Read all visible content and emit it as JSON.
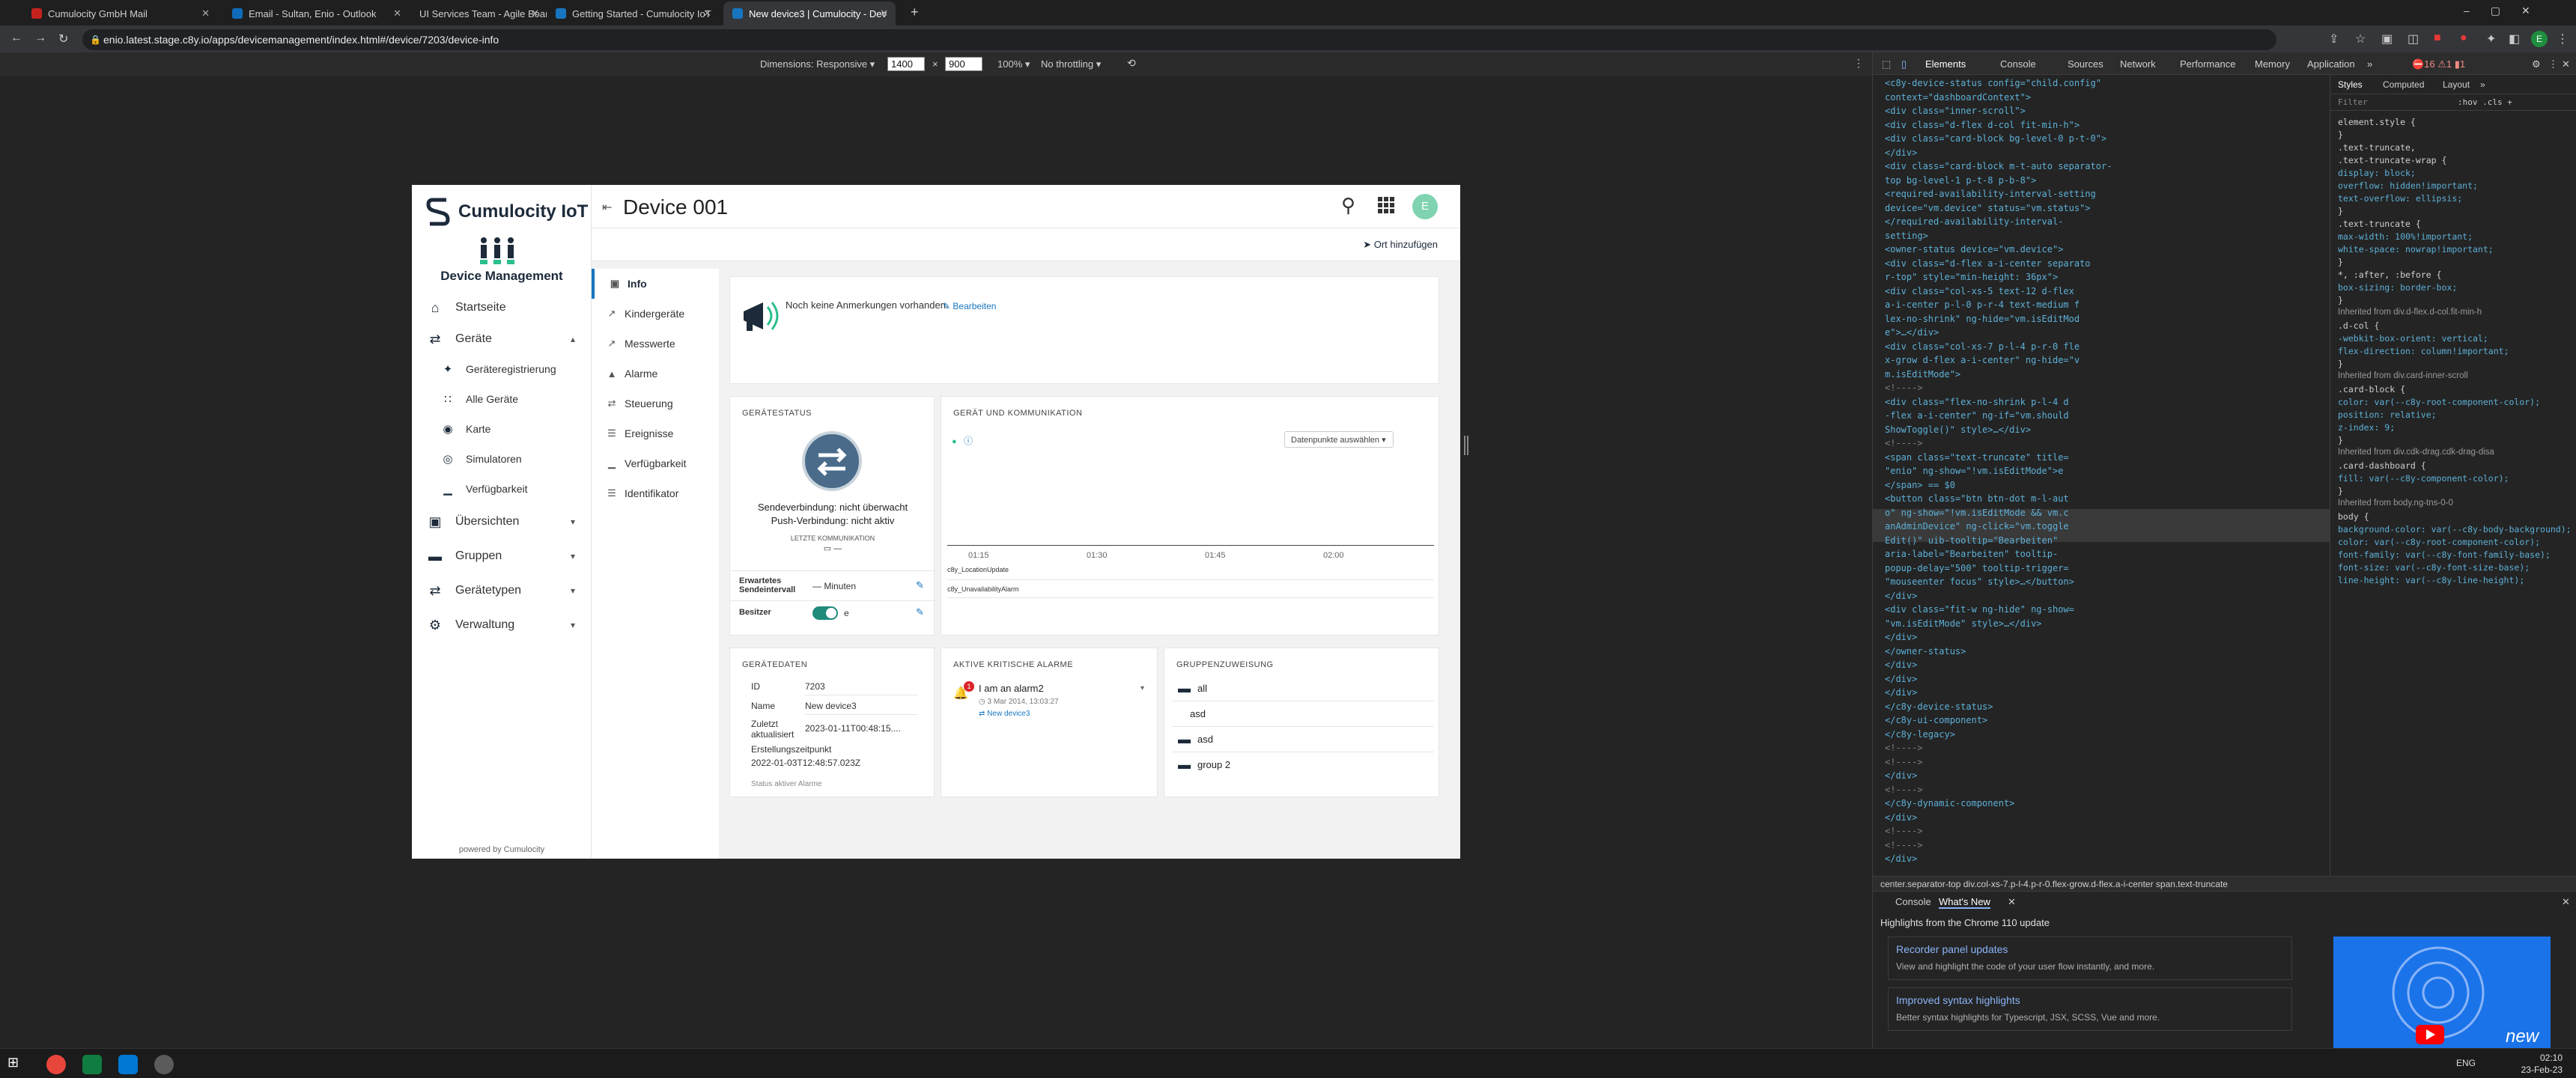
{
  "browser": {
    "tabs": [
      {
        "label": "Cumulocity GmbH Mail",
        "color": "#c5221f"
      },
      {
        "label": "Email - Sultan, Enio - Outlook",
        "color": "#0f6cbd"
      },
      {
        "label": "UI Services Team - Agile Board -",
        "color": "#2684ff"
      },
      {
        "label": "Getting Started - Cumulocity IoT",
        "color": "#1776bf"
      },
      {
        "label": "New device3 | Cumulocity - Dev",
        "color": "#1776bf"
      }
    ],
    "url": "enio.latest.stage.c8y.io/apps/devicemanagement/index.html#/device/7203/device-info"
  },
  "device_toolbar": {
    "dimensions_label": "Dimensions: Responsive ▾",
    "width": "1400",
    "x": "×",
    "height": "900",
    "zoom": "100% ▾",
    "throttling": "No throttling ▾"
  },
  "app": {
    "name": "Cumulocity IoT",
    "module": "Device Management",
    "page_title": "Device 001",
    "add_location": "Ort hinzufügen",
    "avatar": "E",
    "powered_by": "powered by Cumulocity",
    "nav": [
      {
        "label": "Startseite",
        "icon": "⌂"
      },
      {
        "label": "Geräte",
        "icon": "⇄",
        "chevron": "▴"
      },
      {
        "label": "Übersichten",
        "icon": "▣",
        "chevron": "▾"
      },
      {
        "label": "Gruppen",
        "icon": "▬",
        "chevron": "▾"
      },
      {
        "label": "Gerätetypen",
        "icon": "⇄",
        "chevron": "▾"
      },
      {
        "label": "Verwaltung",
        "icon": "⚙",
        "chevron": "▾"
      }
    ],
    "subnav": [
      {
        "label": "Geräteregistrierung",
        "icon": "✦"
      },
      {
        "label": "Alle Geräte",
        "icon": "∷"
      },
      {
        "label": "Karte",
        "icon": "◉"
      },
      {
        "label": "Simulatoren",
        "icon": "◎"
      },
      {
        "label": "Verfügbarkeit",
        "icon": "▁"
      }
    ],
    "tabs": [
      {
        "label": "Info",
        "icon": "▣"
      },
      {
        "label": "Kindergeräte",
        "icon": "↗"
      },
      {
        "label": "Messwerte",
        "icon": "↗"
      },
      {
        "label": "Alarme",
        "icon": "▲"
      },
      {
        "label": "Steuerung",
        "icon": "⇄"
      },
      {
        "label": "Ereignisse",
        "icon": "☰"
      },
      {
        "label": "Verfügbarkeit",
        "icon": "▁"
      },
      {
        "label": "Identifikator",
        "icon": "☰"
      }
    ],
    "notes": {
      "text": "Noch keine Anmerkungen vorhanden.",
      "edit": "Bearbeiten"
    },
    "status": {
      "title": "GERÄTESTATUS",
      "send": "Sendeverbindung: nicht überwacht",
      "push": "Push-Verbindung: nicht aktiv",
      "last_comm_label": "LETZTE KOMMUNIKATION",
      "last_comm_value": "—",
      "interval_label": "Erwartetes Sendeintervall",
      "interval_value": "— Minuten",
      "owner_label": "Besitzer",
      "owner_value": "e"
    },
    "comm": {
      "title": "GERÄT UND KOMMUNIKATION",
      "datapoints": "Datenpunkte auswählen",
      "ticks": [
        "01:15",
        "01:30",
        "01:45",
        "02:00"
      ],
      "series": [
        "c8y_LocationUpdate",
        "c8y_UnavailabilityAlarm"
      ]
    },
    "devdata": {
      "title": "GERÄTEDATEN",
      "rows": [
        {
          "k": "ID",
          "v": "7203"
        },
        {
          "k": "Name",
          "v": "New device3"
        },
        {
          "k": "Zuletzt aktualisiert",
          "v": "2023-01-11T00:48:15...."
        },
        {
          "k": "Erstellungszeitpunkt",
          "v": "2022-01-03T12:48:57.023Z"
        }
      ],
      "footer": "Status aktiver Alarme"
    },
    "alarms": {
      "title": "AKTIVE KRITISCHE ALARME",
      "badge": "1",
      "name": "I am an alarm2",
      "time": "3 Mar 2014, 13:03:27",
      "device": "New device3"
    },
    "groups": {
      "title": "GRUPPENZUWEISUNG",
      "items": [
        {
          "label": "all",
          "icon": true
        },
        {
          "label": "asd",
          "icon": false
        },
        {
          "label": "asd",
          "icon": true
        },
        {
          "label": "group 2",
          "icon": true
        }
      ]
    }
  },
  "devtools": {
    "tabs": [
      "Elements",
      "Console",
      "Sources",
      "Network",
      "Performance",
      "Memory",
      "Application",
      "»"
    ],
    "style_tabs": [
      "Styles",
      "Computed",
      "Layout",
      "»"
    ],
    "filter": "Filter",
    "filter_right": ":hov  .cls  +",
    "breadcrumbs": "center.separator-top    div.col-xs-7.p-l-4.p-r-0.flex-grow.d-flex.a-i-center    span.text-truncate",
    "drawer_tabs": [
      "Console",
      "What's New"
    ],
    "highlights": "Highlights from the Chrome 110 update",
    "cards": [
      {
        "h": "Recorder panel updates",
        "d": "View and highlight the code of your user flow instantly, and more."
      },
      {
        "h": "Improved syntax highlights",
        "d": "Better syntax highlights for Typescript, JSX, SCSS, Vue and more."
      }
    ],
    "video_label": "new",
    "dom": [
      "<c8y-device-status config=\"child.config\"",
      "  context=\"dashboardContext\">",
      "  <div class=\"inner-scroll\">",
      "   <div class=\"d-flex d-col fit-min-h\">",
      "    <div class=\"card-block bg-level-0 p-t-0\">",
      "    </div>",
      "    <div class=\"card-block m-t-auto separator-",
      "    top bg-level-1 p-t-8 p-b-8\">",
      "     <required-availability-interval-setting",
      "     device=\"vm.device\" status=\"vm.status\">",
      "     </required-availability-interval-",
      "     setting>",
      "     <owner-status device=\"vm.device\">",
      "      <div class=\"d-flex a-i-center separato",
      "      r-top\" style=\"min-height: 36px\">",
      "       <div class=\"col-xs-5 text-12 d-flex",
      "       a-i-center p-l-0 p-r-4 text-medium f",
      "       lex-no-shrink\" ng-hide=\"vm.isEditMod",
      "       e\">…</div>",
      "       <div class=\"col-xs-7 p-l-4 p-r-0 fle",
      "       x-grow d-flex a-i-center\" ng-hide=\"v",
      "       m.isEditMode\">",
      "        <!---->",
      "        <div class=\"flex-no-shrink p-l-4 d",
      "        -flex a-i-center\" ng-if=\"vm.should",
      "        ShowToggle()\" style>…</div>",
      "        <!---->",
      "        <span class=\"text-truncate\" title=",
      "        \"enio\" ng-show=\"!vm.isEditMode\">e",
      "        </span> == $0",
      "        <button class=\"btn btn-dot m-l-aut",
      "        o\" ng-show=\"!vm.isEditMode && vm.c",
      "        anAdminDevice\" ng-click=\"vm.toggle",
      "        Edit()\" uib-tooltip=\"Bearbeiten\"",
      "        aria-label=\"Bearbeiten\" tooltip-",
      "        popup-delay=\"500\" tooltip-trigger=",
      "        \"mouseenter focus\" style>…</button>",
      "       </div>",
      "       <div class=\"fit-w ng-hide\" ng-show=",
      "       \"vm.isEditMode\" style>…</div>",
      "      </div>",
      "     </owner-status>",
      "    </div>",
      "   </div>",
      "  </div>",
      " </c8y-device-status>",
      " </c8y-ui-component>",
      " </c8y-legacy>",
      " <!---->",
      " <!---->",
      " </div>",
      " <!---->",
      " </c8y-dynamic-component>",
      " </div>",
      " <!---->",
      " <!---->",
      " </div>"
    ],
    "styles": [
      "element.style {",
      "}",
      ".text-truncate,",
      ".text-truncate-wrap {",
      "  display: block;",
      "  overflow: hidden!important;",
      "  text-overflow: ellipsis;",
      "}",
      ".text-truncate {",
      "  max-width: 100%!important;",
      "  white-space: nowrap!important;",
      "}",
      "*, :after, :before {",
      "  box-sizing: border-box;",
      "}",
      "Inherited from div.d-flex.d-col.fit-min-h",
      ".d-col {",
      "  -webkit-box-orient: vertical;",
      "  flex-direction: column!important;",
      "}",
      "Inherited from div.card-inner-scroll",
      ".card-block {",
      "  color: var(--c8y-root-component-color);",
      "  position: relative;",
      "  z-index: 9;",
      "}",
      "Inherited from div.cdk-drag.cdk-drag-disa",
      ".card-dashboard {",
      "  fill: var(--c8y-component-color);",
      "}",
      "Inherited from body.ng-tns-0-0",
      "body {",
      "  background-color: var(--c8y-body-background);",
      "  color: var(--c8y-root-component-color);",
      "  font-family: var(--c8y-font-family-base);",
      "  font-size: var(--c8y-font-size-base);",
      "  line-height: var(--c8y-line-height);"
    ]
  },
  "taskbar": {
    "lang": "ENG",
    "time": "02:10",
    "date": "23-Feb-23"
  }
}
